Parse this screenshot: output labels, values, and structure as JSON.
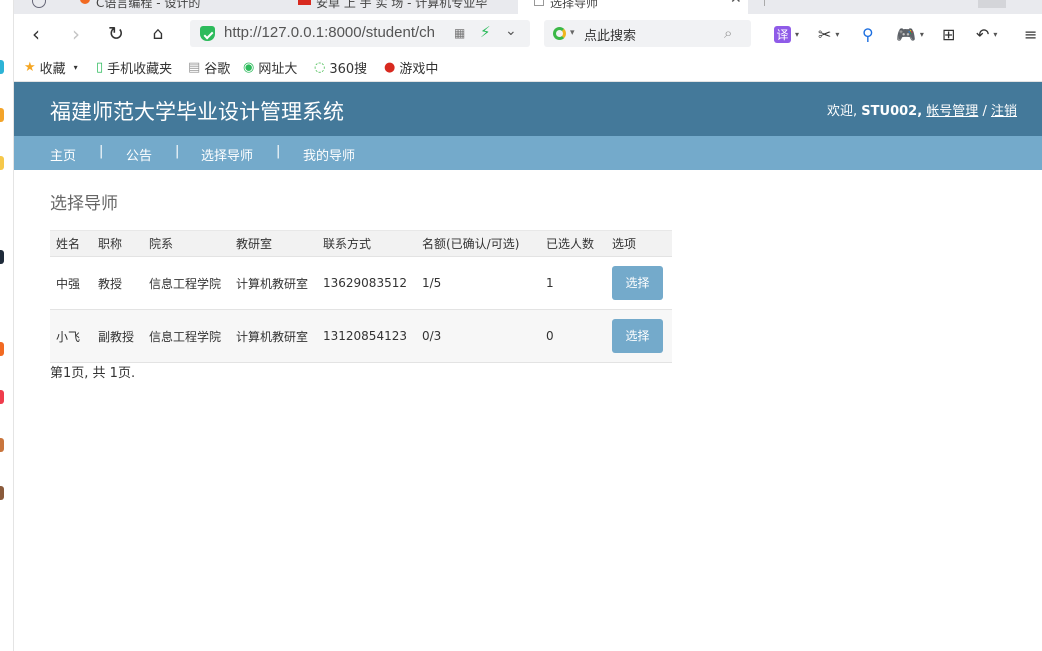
{
  "browser": {
    "tabs": [
      {
        "label": "C语言编程 - 设计的"
      },
      {
        "label": "安卓 上 手 实 场 - 计算机专业毕"
      },
      {
        "label": "选择导师"
      }
    ],
    "url": "http://127.0.0.1:8000/student/ch",
    "search_placeholder": "点此搜索",
    "translate_label": "译",
    "bookmarks": [
      {
        "label": "收藏",
        "icon": "star-icon"
      },
      {
        "label": "手机收藏夹",
        "icon": "phone-icon"
      },
      {
        "label": "谷歌",
        "icon": "page-icon"
      },
      {
        "label": "网址大",
        "icon": "globe-icon"
      },
      {
        "label": "360搜",
        "icon": "360-search-icon"
      },
      {
        "label": "游戏中",
        "icon": "game-center-icon"
      }
    ],
    "accent_colors": {
      "safe": "#2dbb5c",
      "search_logo": "#3bb847",
      "translate": "#8f5be8",
      "game": "#e97a2c"
    }
  },
  "site": {
    "title": "福建师范大学毕业设计管理系统",
    "welcome_prefix": "欢迎,",
    "username": "STU002,",
    "account_link": "帐号管理",
    "separator": "/",
    "logout_link": "注销",
    "header_color": "#44799a",
    "menu_color": "#74aacb",
    "menu": [
      {
        "label": "主页"
      },
      {
        "label": "公告"
      },
      {
        "label": "选择导师"
      },
      {
        "label": "我的导师"
      }
    ],
    "menu_separator": "|"
  },
  "main": {
    "heading": "选择导师",
    "columns": [
      "姓名",
      "职称",
      "院系",
      "教研室",
      "联系方式",
      "名额(已确认/可选)",
      "已选人数",
      "选项"
    ],
    "rows": [
      {
        "name": "中强",
        "title": "教授",
        "dept": "信息工程学院",
        "office": "计算机教研室",
        "phone": "13629083512",
        "quota": "1/5",
        "selected": "1",
        "action": "选择"
      },
      {
        "name": "小飞",
        "title": "副教授",
        "dept": "信息工程学院",
        "office": "计算机教研室",
        "phone": "13120854123",
        "quota": "0/3",
        "selected": "0",
        "action": "选择"
      }
    ],
    "pagination": "第1页, 共 1页."
  }
}
